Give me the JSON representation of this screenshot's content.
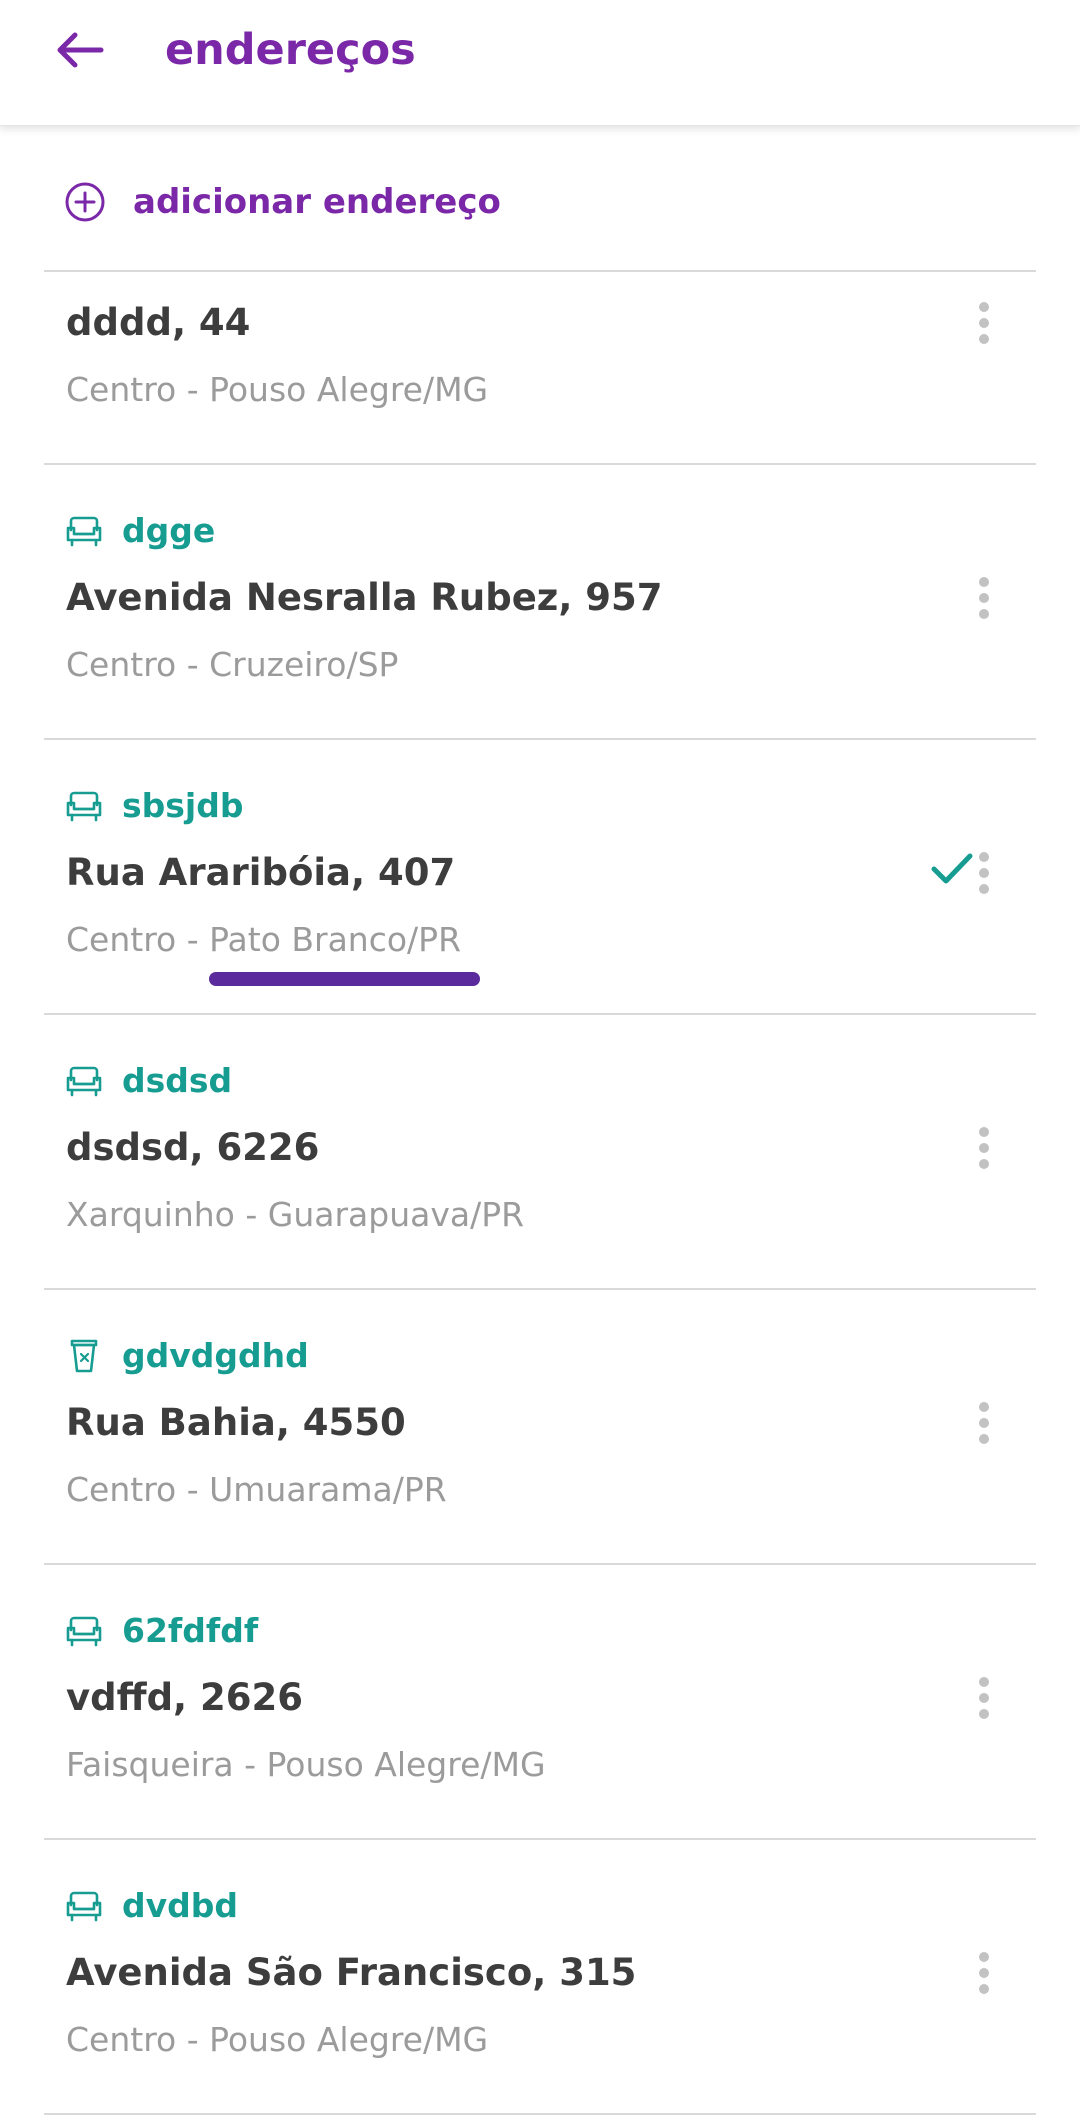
{
  "header": {
    "back_icon": "arrow-left-icon",
    "title": "endereços"
  },
  "add_address": {
    "icon": "plus-circle-icon",
    "label": "adicionar endereço"
  },
  "colors": {
    "brand_purple": "#7b28a8",
    "nickname_teal": "#169c91",
    "street_text": "#3d3d3d",
    "city_text": "#9b9b9b",
    "divider": "#d9d9d9",
    "underline_mark": "#5b2a9c"
  },
  "addresses": [
    {
      "nickname": "",
      "icon": "",
      "street": "dddd, 44",
      "city": "Centro - Pouso Alegre/MG",
      "selected": false
    },
    {
      "nickname": "dgge",
      "icon": "armchair-icon",
      "street": "Avenida Nesralla Rubez, 957",
      "city": "Centro - Cruzeiro/SP",
      "selected": false
    },
    {
      "nickname": "sbsjdb",
      "icon": "armchair-icon",
      "street": "Rua Araribóia, 407",
      "city": "Centro - Pato Branco/PR",
      "selected": true
    },
    {
      "nickname": "dsdsd",
      "icon": "armchair-icon",
      "street": "dsdsd, 6226",
      "city": "Xarquinho - Guarapuava/PR",
      "selected": false
    },
    {
      "nickname": "gdvdgdhd",
      "icon": "coffee-cup-icon",
      "street": "Rua Bahia, 4550",
      "city": "Centro - Umuarama/PR",
      "selected": false
    },
    {
      "nickname": "62fdfdf",
      "icon": "armchair-icon",
      "street": "vdffd, 2626",
      "city": "Faisqueira - Pouso Alegre/MG",
      "selected": false
    },
    {
      "nickname": "dvdbd",
      "icon": "armchair-icon",
      "street": "Avenida São Francisco, 315",
      "city": "Centro - Pouso Alegre/MG",
      "selected": false
    }
  ],
  "selected_icon": "check-icon",
  "item_menu_icon": "more-vertical-icon"
}
